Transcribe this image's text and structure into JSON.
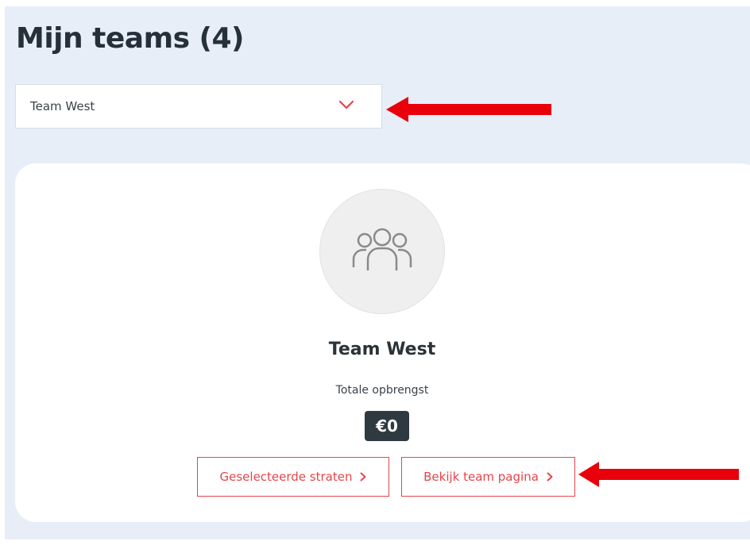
{
  "header": {
    "title": "Mijn teams (4)"
  },
  "team_select": {
    "selected": "Team West",
    "icon": "chevron-down-icon"
  },
  "team_card": {
    "avatar_icon": "group-icon",
    "name": "Team West",
    "revenue_label": "Totale opbrengst",
    "revenue_value": "€0"
  },
  "actions": {
    "selected_streets_label": "Geselecteerde straten",
    "team_page_label": "Bekijk team pagina"
  },
  "colors": {
    "accent": "#e8434a",
    "annotation": "#e8000a",
    "page_background": "#e8eef8",
    "badge_background": "#2e3a40"
  }
}
